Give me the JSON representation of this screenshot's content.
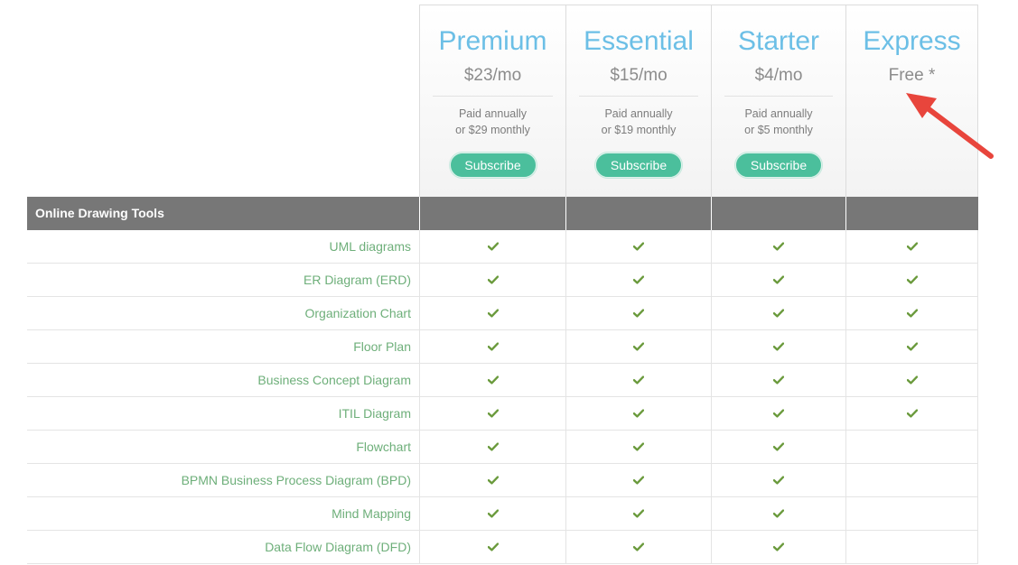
{
  "plans": [
    {
      "name": "Premium",
      "price": "$23/mo",
      "note1": "Paid annually",
      "note2": "or $29 monthly",
      "button": "Subscribe"
    },
    {
      "name": "Essential",
      "price": "$15/mo",
      "note1": "Paid annually",
      "note2": "or $19 monthly",
      "button": "Subscribe"
    },
    {
      "name": "Starter",
      "price": "$4/mo",
      "note1": "Paid annually",
      "note2": "or $5 monthly",
      "button": "Subscribe"
    },
    {
      "name": "Express",
      "price": "Free *"
    }
  ],
  "section": {
    "title": "Online Drawing Tools"
  },
  "features": [
    {
      "label": "UML diagrams",
      "checks": [
        true,
        true,
        true,
        true
      ]
    },
    {
      "label": "ER Diagram (ERD)",
      "checks": [
        true,
        true,
        true,
        true
      ]
    },
    {
      "label": "Organization Chart",
      "checks": [
        true,
        true,
        true,
        true
      ]
    },
    {
      "label": "Floor Plan",
      "checks": [
        true,
        true,
        true,
        true
      ]
    },
    {
      "label": "Business Concept Diagram",
      "checks": [
        true,
        true,
        true,
        true
      ]
    },
    {
      "label": "ITIL Diagram",
      "checks": [
        true,
        true,
        true,
        true
      ]
    },
    {
      "label": "Flowchart",
      "checks": [
        true,
        true,
        true,
        false
      ]
    },
    {
      "label": "BPMN Business Process Diagram (BPD)",
      "checks": [
        true,
        true,
        true,
        false
      ]
    },
    {
      "label": "Mind Mapping",
      "checks": [
        true,
        true,
        true,
        false
      ]
    },
    {
      "label": "Data Flow Diagram (DFD)",
      "checks": [
        true,
        true,
        true,
        false
      ]
    }
  ],
  "icons": {
    "check": "check-icon",
    "annotation": "red-arrow-icon"
  },
  "colors": {
    "plan_name": "#6cbfe6",
    "button": "#4bbf9c",
    "check": "#6a9a3c",
    "feature_label": "#6eaf7a",
    "section_bg": "#777777",
    "arrow": "#e8453c"
  }
}
